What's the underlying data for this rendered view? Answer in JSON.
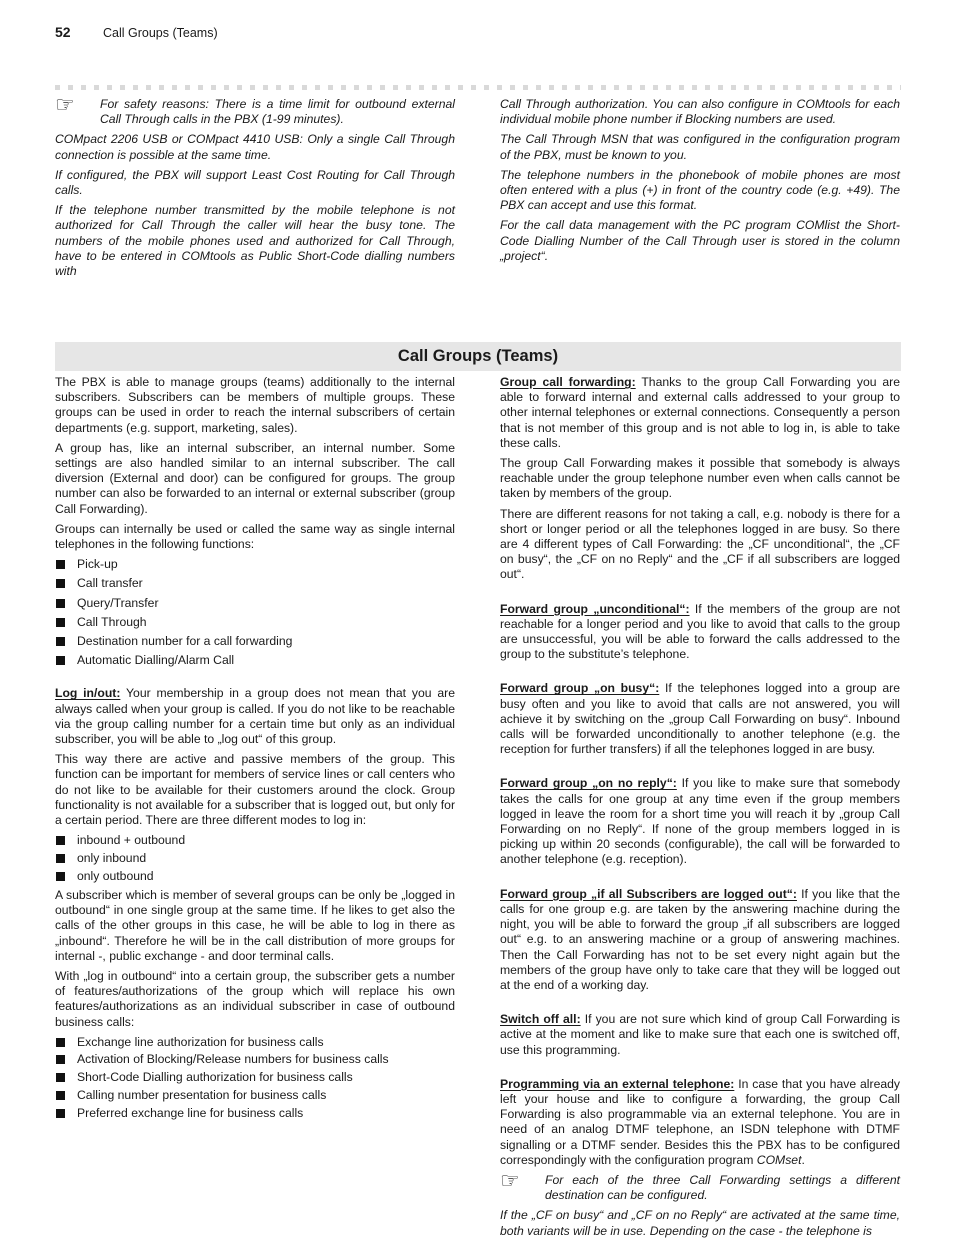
{
  "header": {
    "page_number": "52",
    "running_title": "Call Groups (Teams)"
  },
  "top": {
    "left": {
      "note": "For safety reasons: There is a time limit for outbound external Call Through calls in the PBX (1-99 minutes).",
      "paragraphs": [
        "COMpact 2206 USB or COMpact 4410 USB: Only a single Call Through connection is possible at the same time.",
        "If configured, the PBX will support Least Cost Routing for Call Through calls.",
        "If the telephone number transmitted by the mobile telephone is not authorized for Call Through the caller will hear the busy tone. The numbers of the mobile phones used and authorized for Call Through, have to be entered in COMtools as Public Short-Code dialling numbers with"
      ]
    },
    "right": {
      "paragraphs": [
        "Call Through authorization. You can also configure in COMtools for each individual mobile phone number if Blocking numbers are used.",
        "The Call Through MSN that was configured in the configuration program of the PBX, must be known to you.",
        "The telephone numbers in the phonebook of mobile phones are most often entered with a plus (+) in front of the country code (e.g. +49). The PBX can accept and use this format.",
        "For the call data management with the PC program COMlist the Short-Code Dialling Number of the Call Through user is stored in the column „project“."
      ]
    }
  },
  "section": {
    "title": "Call Groups (Teams)",
    "left": {
      "p1": "The PBX is able to manage groups (teams) additionally to the internal subscribers. Subscribers can be members of multiple groups. These groups can be used in order to reach the internal subscribers of certain departments (e.g. support, marketing, sales).",
      "p2": "A group has, like an internal subscriber, an internal number. Some settings are also handled similar to an internal subscriber. The call diversion (External and door) can be configured for groups. The group number can also be forwarded to an internal or external subscriber (group Call Forwarding).",
      "p3": "Groups can internally be used or called the same way as single internal telephones in the following functions:",
      "functions": [
        "Pick-up",
        "Call transfer",
        "Query/Transfer",
        "Call Through",
        "Destination number for a call forwarding",
        "Automatic Dialling/Alarm Call"
      ],
      "login_term": "Log in/out:",
      "login_text": " Your membership in a group does not mean that you are always called when your group is called. If you do not like to be reachable via the group calling number for a certain time but only as an individual subscriber, you will be able to „log out“ of this group.",
      "p4": "This way there are active and passive members of the group. This function can be important for members of service lines or call centers who do not like to be available for their customers around the clock. Group functionality is not available for a subscriber that is logged out, but only for a certain period. There are three different modes to log in:",
      "modes": [
        "inbound + outbound",
        "only inbound",
        "only outbound"
      ],
      "p5": "A subscriber which is member of several groups can be only be „logged in outbound“ in one single group at the same time. If he likes to get also the calls of the other groups in this case, he will be able to log in there as „inbound“. Therefore he will be in the call distribution of more groups for internal -, public exchange - and door terminal calls.",
      "p6": "With „log in outbound“ into a certain group, the subscriber gets a number of features/authorizations of the group which will replace his own features/authorizations as an individual subscriber in case of outbound business calls:",
      "features": [
        "Exchange line authorization for business calls",
        "Activation of Blocking/Release numbers for business calls",
        "Short-Code Dialling authorization for business calls",
        "Calling number presentation for business calls",
        "Preferred exchange line for business calls"
      ]
    },
    "right": {
      "gcf_term": "Group call forwarding:",
      "gcf_text": " Thanks to the group Call Forwarding you are able to forward internal and external calls addressed to your group to other internal telephones or external connections. Consequently a person that is not member of this group and is not able to log in, is able to take these calls.",
      "p2": "The group Call Forwarding makes it possible that somebody is always reachable under the group telephone number even when calls cannot be taken by members of the group.",
      "p3": "There are different reasons for not taking a call, e.g. nobody is there for a short or longer period or all the telephones logged in are busy. So there are 4 different types of Call Forwarding: the „CF unconditional“, the „CF on busy“, the „CF on no Reply“ and the „CF if all subscribers are logged out“.",
      "uncond_term": "Forward group „unconditional“:",
      "uncond_text": " If the members of the group are not reachable for a longer period and you like to avoid that calls to the group are unsuccessful, you will be able to forward the calls addressed to the group to the substitute’s telephone.",
      "busy_term": "Forward group „on busy“:",
      "busy_text": " If the telephones logged into a group are busy often and you like to avoid that calls are not answered, you will achieve it by switching on the „group Call Forwarding on busy“. Inbound calls will be forwarded unconditionally to another telephone (e.g. the reception for further transfers) if all the telephones logged in are busy.",
      "noreply_term": "Forward group „on no reply“:",
      "noreply_text": " If you like to make sure that somebody takes the calls for one group at any time even if the group members logged in leave the room for a short time you will reach it by „group Call Forwarding on no Reply“. If none of the group members logged in is picking up within 20 seconds (configurable), the call will be forwarded to another telephone (e.g. reception).",
      "loggedout_term": "Forward group „if all Subscribers are logged out“:",
      "loggedout_text": " If you like that the calls for one group e.g. are taken by the answering machine during the night, you will be able to forward the group „if all subscribers are logged out“ e.g. to an answering machine or a group of answering machines. Then the Call Forwarding has not to be set every night again but the members of the group have only to take care that they will be logged out at the end of a working day.",
      "switchoff_term": "Switch off all:",
      "switchoff_text": " If you are not sure which kind of group Call Forwarding is active at the moment and like to make sure that each one is switched off, use this programming.",
      "prog_term": "Programming via an external telephone:",
      "prog_text": " In case that you have already left your house and like to configure a forwarding, the group Call Forwarding is also programmable via an external telephone. You are in need of an analog DTMF telephone, an ISDN telephone with DTMF signalling or a DTMF sender. Besides this the PBX has to be configured correspondingly with the configuration program ",
      "prog_program": "COMset",
      "prog_end": ".",
      "note": "For each of the three Call Forwarding settings a different destination can be configured.",
      "last": "If the „CF on busy“ and „CF on no Reply“ are activated at the same time, both variants will be in use. Depending on the case - the telephone is"
    }
  },
  "icons": {
    "hand_pointer": "☞"
  }
}
